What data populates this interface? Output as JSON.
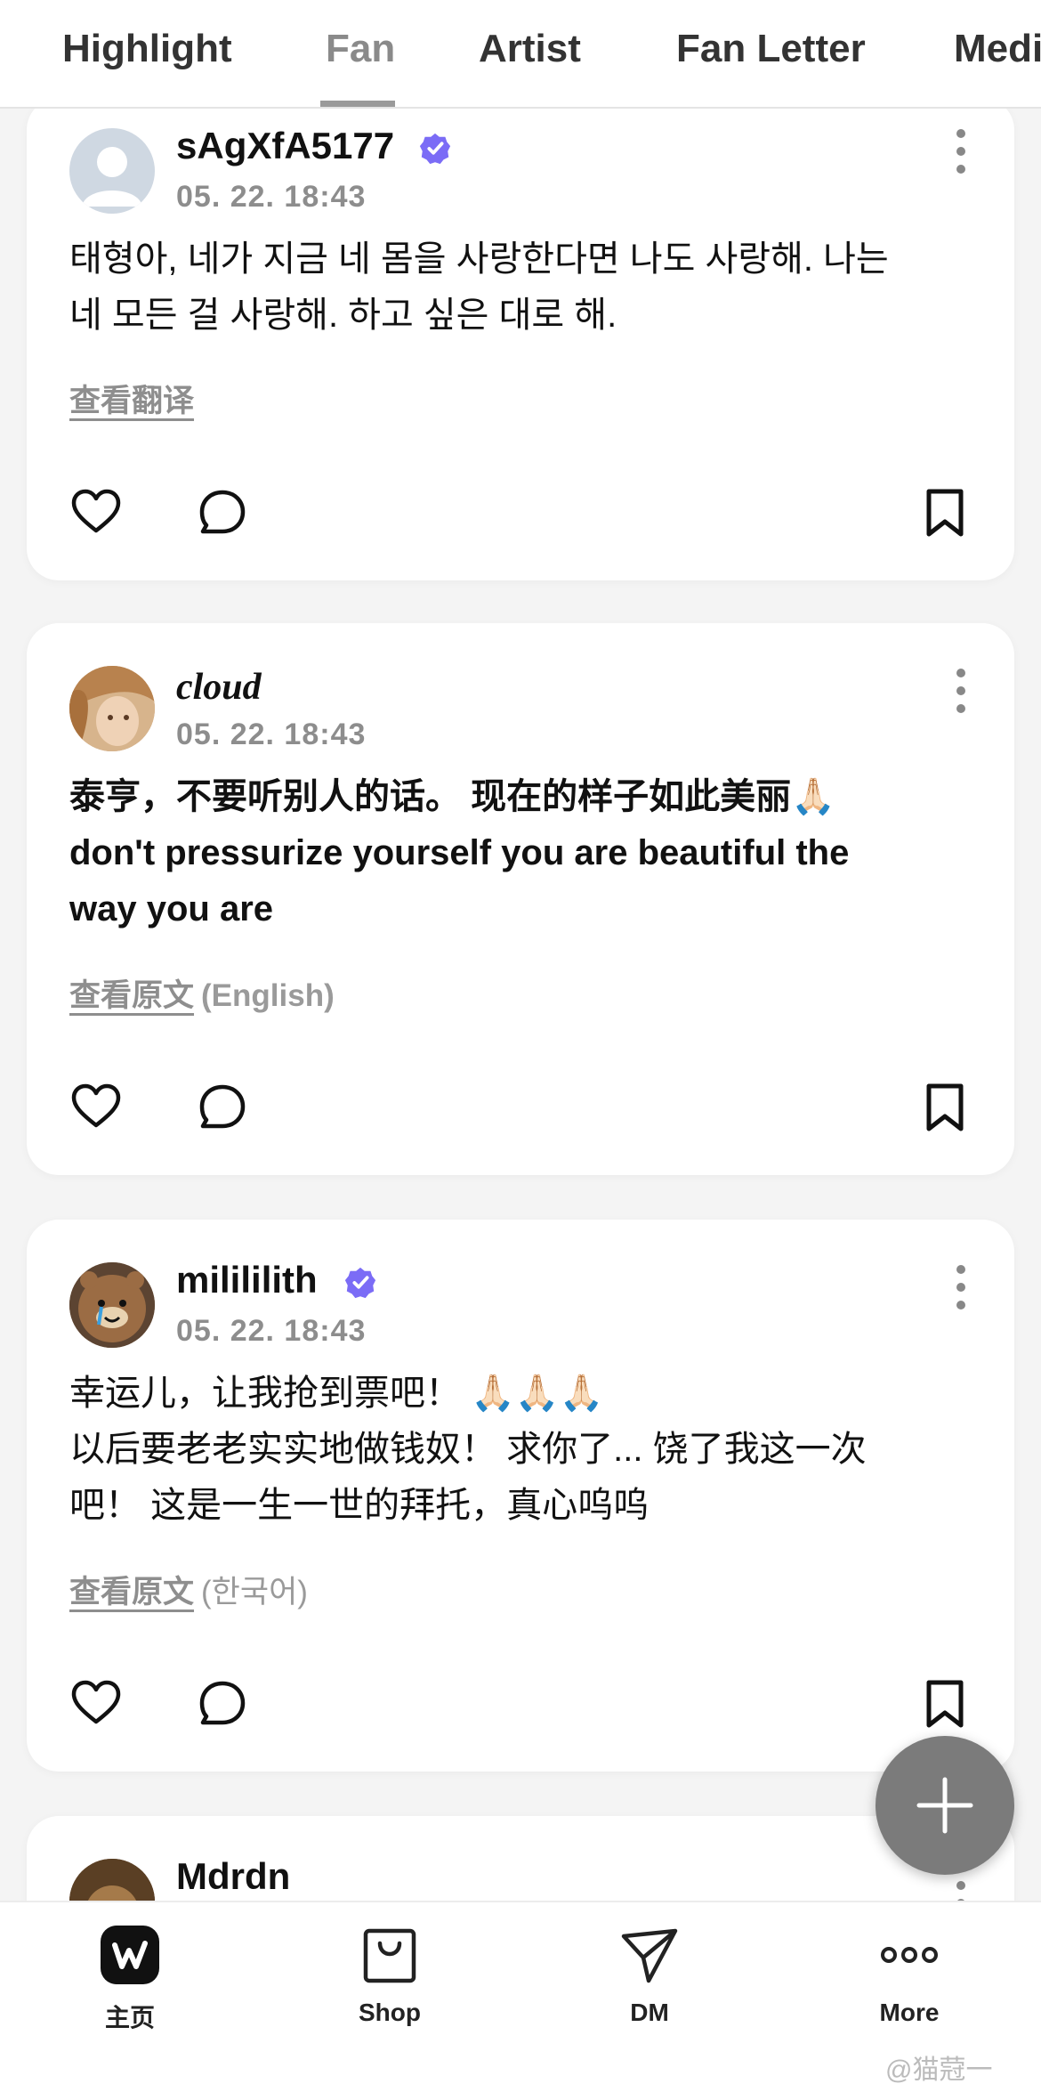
{
  "tabs": [
    "Highlight",
    "Fan",
    "Artist",
    "Fan Letter",
    "Medi"
  ],
  "active_tab": "Fan",
  "posts": [
    {
      "username": "sAgXfA5177",
      "verified": true,
      "time": "05. 22. 18:43",
      "lines": [
        "태형아, 네가 지금 네 몸을 사랑한다면 나도 사랑해. 나는",
        "네 모든 걸 사랑해. 하고 싶은 대로 해."
      ],
      "translate_link": "查看翻译",
      "translate_lang": "",
      "avatar": "default-avatar-icon"
    },
    {
      "username": "cloud",
      "verified": false,
      "time": "05. 22. 18:43",
      "lines": [
        "泰亨，不要听别人的话。 现在的样子如此美丽🙏🏻",
        "don't pressurize yourself you are beautiful the",
        "way you are"
      ],
      "translate_link": "查看原文",
      "translate_lang": "(English)",
      "avatar": "user-photo-avatar"
    },
    {
      "username": "milililith",
      "verified": true,
      "time": "05. 22. 18:43",
      "lines": [
        "幸运儿，让我抢到票吧！ 🙏🏻🙏🏻🙏🏻",
        "以后要老老实实地做钱奴！ 求你了... 饶了我这一次",
        "吧！ 这是一生一世的拜托，真心呜呜"
      ],
      "translate_link": "查看原文",
      "translate_lang": "(한국어)",
      "avatar": "plush-toy-avatar"
    },
    {
      "username": "Mdrdn",
      "verified": false,
      "avatar": "user-photo-avatar"
    }
  ],
  "bottom_nav": [
    {
      "label": "主页",
      "icon": "weverse-home-icon"
    },
    {
      "label": "Shop",
      "icon": "shopping-bag-icon"
    },
    {
      "label": "DM",
      "icon": "paper-plane-icon"
    },
    {
      "label": "More",
      "icon": "more-dots-icon"
    }
  ],
  "watermark": "@猫蒄一",
  "colors": {
    "verified_badge": "#7b6cf6",
    "fab": "#7b7b7b",
    "active_tab": "#8a8a8a"
  }
}
